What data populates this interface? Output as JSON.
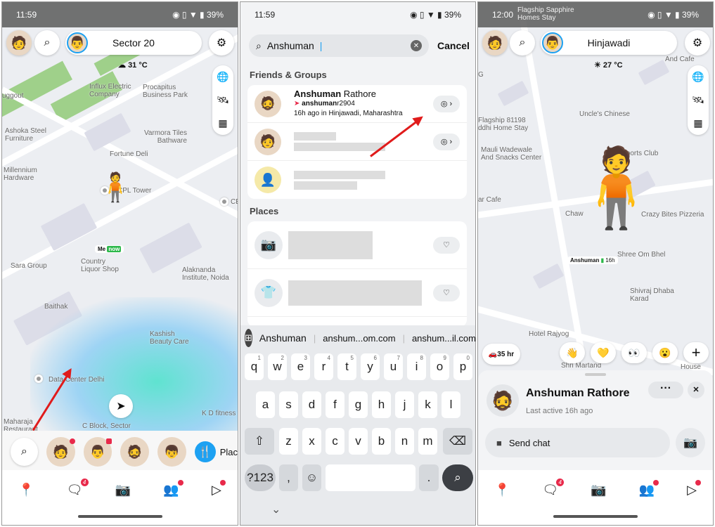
{
  "panel1": {
    "status": {
      "time": "11:59",
      "battery": "39%"
    },
    "location_title": "Sector 20",
    "weather": "31 °C",
    "map_labels": [
      "Influx Electric\nCompany",
      "Procapitus\nBusiness Park",
      "uggout",
      "Ashoka Steel\nFurniture",
      "Varmora Tiles\nBathware",
      "Fortune Deli",
      "Millennium\nHardware",
      "CPL Tower",
      "CE",
      "Sara Group",
      "Country\nLiquor Shop",
      "Alaknanda\nInstitute, Noida",
      "Baithak",
      "Kashish\nBeauty Care",
      "Data Center Delhi",
      "K D fitness",
      "C Block, Sector",
      "Maharaja\nRestaurant"
    ],
    "me_label": "Me",
    "me_status": "now",
    "tray_places_label": "Plac",
    "nav": {
      "chat_badge": "4"
    },
    "icons": [
      "search-icon",
      "settings-icon",
      "globe-icon",
      "satellite-icon",
      "memories-icon",
      "locate-icon"
    ]
  },
  "panel2": {
    "status": {
      "time": "11:59",
      "battery": "39%"
    },
    "search_value": "Anshuman",
    "cancel_label": "Cancel",
    "friends_heading": "Friends & Groups",
    "friend": {
      "first": "Anshuman",
      "last": " Rathore",
      "user_bold": "anshuman",
      "user_rest": "r2904",
      "location": "16h ago in Hinjawadi, Maharashtra"
    },
    "places_heading": "Places",
    "suggestions": [
      "Anshuman",
      "anshum...om.com",
      "anshum...il.com"
    ],
    "keyboard": {
      "row1": [
        "q",
        "w",
        "e",
        "r",
        "t",
        "y",
        "u",
        "i",
        "o",
        "p"
      ],
      "row1_hints": [
        "1",
        "2",
        "3",
        "4",
        "5",
        "6",
        "7",
        "8",
        "9",
        "0"
      ],
      "row2": [
        "a",
        "s",
        "d",
        "f",
        "g",
        "h",
        "j",
        "k",
        "l"
      ],
      "row3": [
        "z",
        "x",
        "c",
        "v",
        "b",
        "n",
        "m"
      ],
      "symbols": "?123",
      "comma": ",",
      "period": "."
    }
  },
  "panel3": {
    "status": {
      "time": "12:00",
      "battery": "39%"
    },
    "location_title": "Hinjawadi",
    "weather": "27 °C",
    "map_labels": [
      "Flagship Sapphire\nHomes Stay",
      "Flagship 81198\nddhi Home Stay",
      "Uncle's Chinese",
      "Mauli Wadewale\nAnd Snacks Center",
      "SK Sports Club",
      "ar Cafe",
      "Chaw",
      "Crazy Bites Pizzeria",
      "Shree Om Bhel",
      "Shivraj Dhaba\nKarad",
      "Hotel Rajyog",
      "Shri Martand",
      "House",
      "And Cafe",
      "G"
    ],
    "friend_label": "Anshuman",
    "friend_time": "16h",
    "drive_time": "35 hr",
    "reactions": [
      "👋",
      "💛",
      "👀",
      "😮",
      "+"
    ],
    "profile": {
      "name": "Anshuman Rathore",
      "last_active": "Last active 16h ago",
      "send_chat": "Send chat"
    },
    "nav": {
      "chat_badge": "4"
    }
  },
  "colors": {
    "accent_blue": "#1da1f2",
    "badge_red": "#e8294a",
    "arrow_red": "#e01b1b"
  }
}
